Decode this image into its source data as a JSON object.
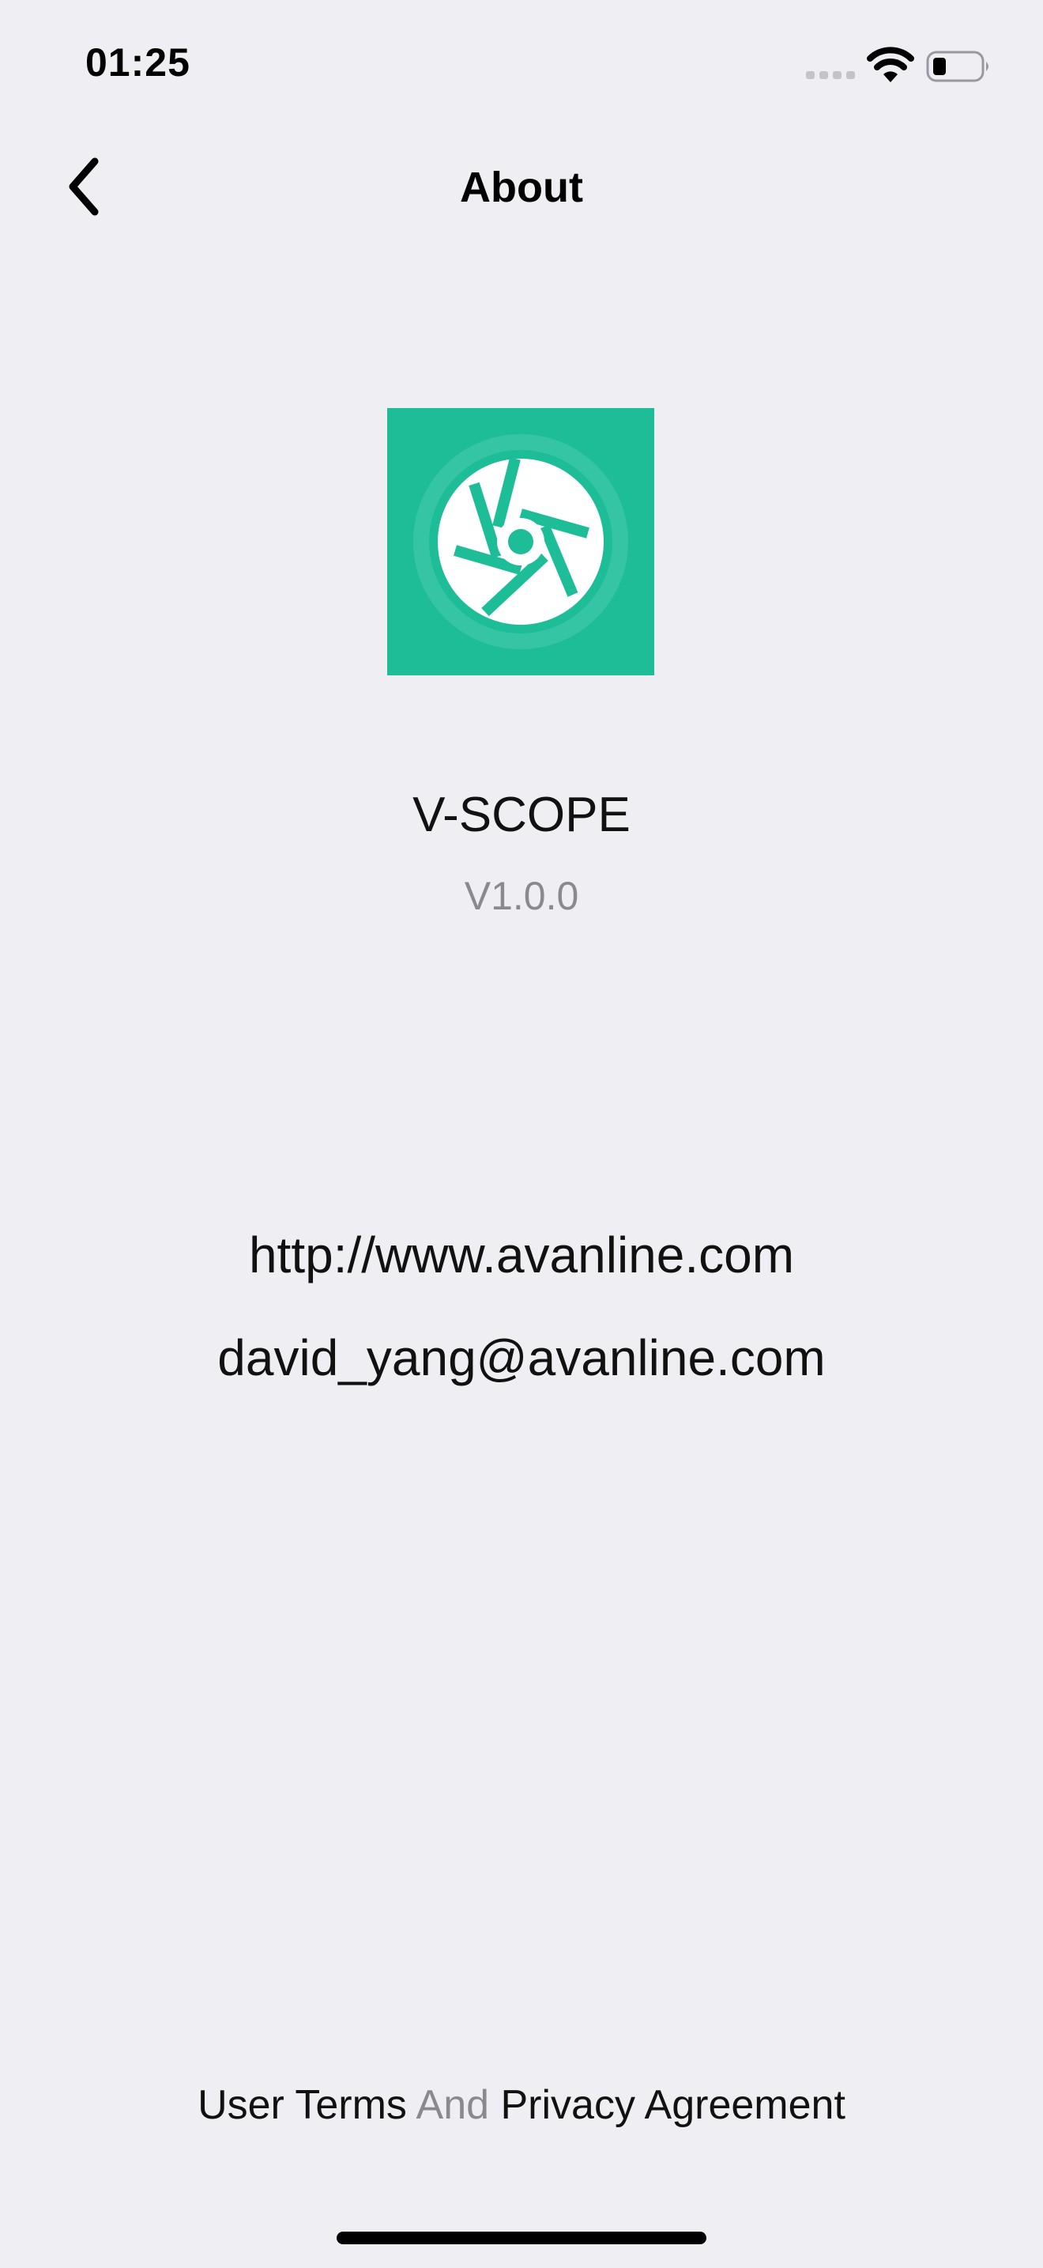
{
  "status_bar": {
    "time": "01:25"
  },
  "nav": {
    "title": "About",
    "back_icon": "chevron-left-icon"
  },
  "app": {
    "name": "V-SCOPE",
    "version": "V1.0.0",
    "icon": "camera-shutter-icon",
    "icon_color": "#1dbd97"
  },
  "contact": {
    "website": "http://www.avanline.com",
    "email": "david_yang@avanline.com"
  },
  "footer": {
    "terms_label": "User Terms",
    "conjunction": "And",
    "privacy_label": "Privacy Agreement"
  },
  "colors": {
    "background": "#efeef2",
    "secondary_text": "#8a8a8e"
  }
}
